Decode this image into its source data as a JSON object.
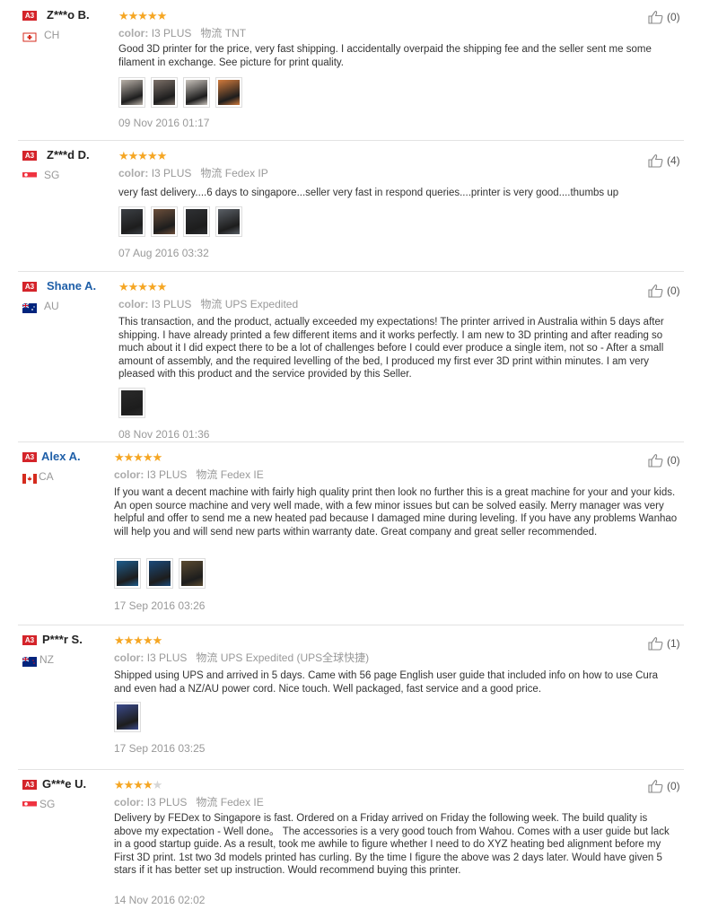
{
  "labels": {
    "color_label": "color:",
    "logistics_label": "物流"
  },
  "reviews": [
    {
      "badge": "A3",
      "name": "Z***o B.",
      "country": "CH",
      "stars": 5,
      "color_value": "I3 PLUS",
      "shipping": "TNT",
      "text": "Good 3D printer for the price, very fast shipping. I accidentally overpaid the shipping fee and the seller sent me some filament in exchange. See picture for print quality.",
      "photos": [
        "print photo",
        "print photo",
        "print photo",
        "print photo"
      ],
      "date": "09 Nov 2016 01:17",
      "likes": "(0)"
    },
    {
      "badge": "A3",
      "name": "Z***d D.",
      "country": "SG",
      "stars": 5,
      "color_value": "I3 PLUS",
      "shipping": "Fedex IP",
      "text": "very fast delivery....6 days to singapore...seller very fast in respond queries....printer is very good....thumbs up",
      "photos": [
        "print photo",
        "print photo",
        "print photo",
        "print photo"
      ],
      "date": "07 Aug 2016 03:32",
      "likes": "(4)"
    },
    {
      "badge": "A3",
      "name": "Shane A.",
      "country": "AU",
      "stars": 5,
      "color_value": "I3 PLUS",
      "shipping": "UPS Expedited",
      "text": "This transaction, and the product, actually exceeded my expectations! The printer arrived in Australia within 5 days after shipping. I have already printed a few different items and it works perfectly. I am new to 3D printing and after reading so much about it I did expect there to be a lot of challenges before I could ever produce a single item, not so - After a small amount of assembly, and the required levelling of the bed, I produced my first ever 3D print within minutes. I am very pleased with this product and the service provided by this Seller.",
      "photos": [
        "print photo"
      ],
      "date": "08 Nov 2016 01:36",
      "likes": "(0)"
    },
    {
      "badge": "A3",
      "name": "Alex A.",
      "country": "CA",
      "stars": 5,
      "color_value": "I3 PLUS",
      "shipping": "Fedex IE",
      "text": "If you want a decent machine with fairly high quality print then look no further this is a great machine for your and your kids. An open source machine and very well made, with a few minor issues but can be solved easily. Merry manager was very helpful and offer to send me a new heated pad because I damaged mine during leveling. If you have any problems Wanhao will help you and will send new parts within warranty date. Great company and great seller recommended.",
      "photos": [
        "print photo",
        "print photo",
        "print photo"
      ],
      "date": "17 Sep 2016 03:26",
      "likes": "(0)"
    },
    {
      "badge": "A3",
      "name": "P***r S.",
      "country": "NZ",
      "stars": 5,
      "color_value": "I3 PLUS",
      "shipping": "UPS Expedited (UPS全球快捷)",
      "text": "Shipped using UPS and arrived in 5 days. Came with 56 page English user guide that included info on how to use Cura and even had a NZ/AU power cord. Nice touch. Well packaged, fast service and a good price.",
      "photos": [
        "print photo"
      ],
      "date": "17 Sep 2016 03:25",
      "likes": "(1)"
    },
    {
      "badge": "A3",
      "name": "G***e U.",
      "country": "SG",
      "stars": 4,
      "color_value": "I3 PLUS",
      "shipping": "Fedex IE",
      "text": "Delivery by FEDex to Singapore is fast. Ordered on a Friday arrived on Friday the following week. The build quality is above my expectation - Well done。 The accessories is a very good touch from Wahou. Comes with a user guide but lack in a good startup guide. As a result, took me awhile to figure whether I need to do XYZ heating bed alignment before my First 3D print. 1st two 3d models printed has curling. By the time I figure the above was 2 days later. Would have given 5 stars if it has better set up instruction. Would recommend buying this printer.",
      "photos": [],
      "date": "14 Nov 2016 02:02",
      "likes": "(0)"
    }
  ]
}
